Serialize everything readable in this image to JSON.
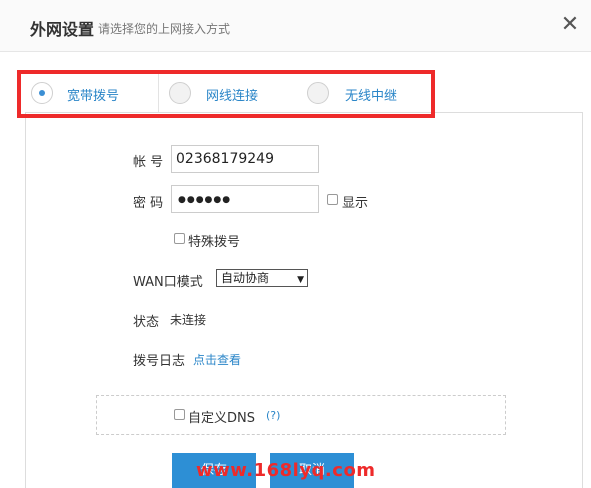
{
  "header": {
    "title": "外网设置",
    "subtitle": "请选择您的上网接入方式",
    "close_glyph": "✕"
  },
  "tabs": [
    {
      "label": "宽带拨号",
      "active": true
    },
    {
      "label": "网线连接",
      "active": false
    },
    {
      "label": "无线中继",
      "active": false
    }
  ],
  "form": {
    "account_label": "帐 号",
    "account_value": "02368179249",
    "password_label": "密 码",
    "password_dots": "●●●●●●",
    "show_label": "显示",
    "special_dial_label": "特殊拨号",
    "wan_mode_label": "WAN口模式",
    "wan_mode_value": "自动协商",
    "status_label": "状态",
    "status_value": "未连接",
    "log_label": "拨号日志",
    "log_link": "点击查看",
    "custom_dns_label": "自定义DNS",
    "help_link": "(?)"
  },
  "buttons": {
    "save": "保存",
    "cancel": "取消"
  },
  "watermark": "www.168lyq.com",
  "colors": {
    "accent": "#2d8fd5",
    "highlight": "#ee2a2a"
  }
}
